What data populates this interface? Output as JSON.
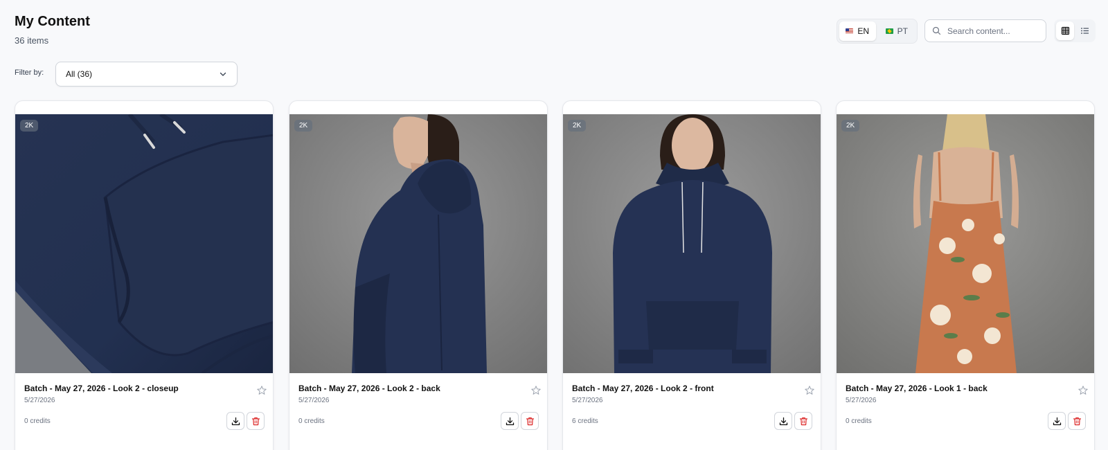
{
  "header": {
    "title": "My Content",
    "item_count": "36 items"
  },
  "filter": {
    "label": "Filter by:",
    "selected": "All (36)"
  },
  "language": {
    "options": [
      {
        "code": "EN",
        "flag": "us-flag-icon",
        "active": true
      },
      {
        "code": "PT",
        "flag": "brazil-flag-icon",
        "active": false
      }
    ]
  },
  "search": {
    "placeholder": "Search content...",
    "value": ""
  },
  "view_toggle": {
    "options": [
      {
        "name": "grid-view",
        "icon": "grid-icon",
        "active": true
      },
      {
        "name": "list-view",
        "icon": "list-icon",
        "active": false
      }
    ]
  },
  "cards": [
    {
      "title": "Batch - May 27, 2026 - Look 2 - closeup",
      "date": "5/27/2026",
      "credits": "0 credits",
      "resolution": "2K"
    },
    {
      "title": "Batch - May 27, 2026 - Look 2 - back",
      "date": "5/27/2026",
      "credits": "0 credits",
      "resolution": "2K"
    },
    {
      "title": "Batch - May 27, 2026 - Look 2 - front",
      "date": "5/27/2026",
      "credits": "6 credits",
      "resolution": "2K"
    },
    {
      "title": "Batch - May 27, 2026 - Look 1 - back",
      "date": "5/27/2026",
      "credits": "0 credits",
      "resolution": "2K"
    }
  ],
  "colors": {
    "navy_garment": "#1f2a44",
    "studio_gray": "#8a8a8a",
    "dress_orange": "#c8794e",
    "delete_red": "#dc2626"
  }
}
